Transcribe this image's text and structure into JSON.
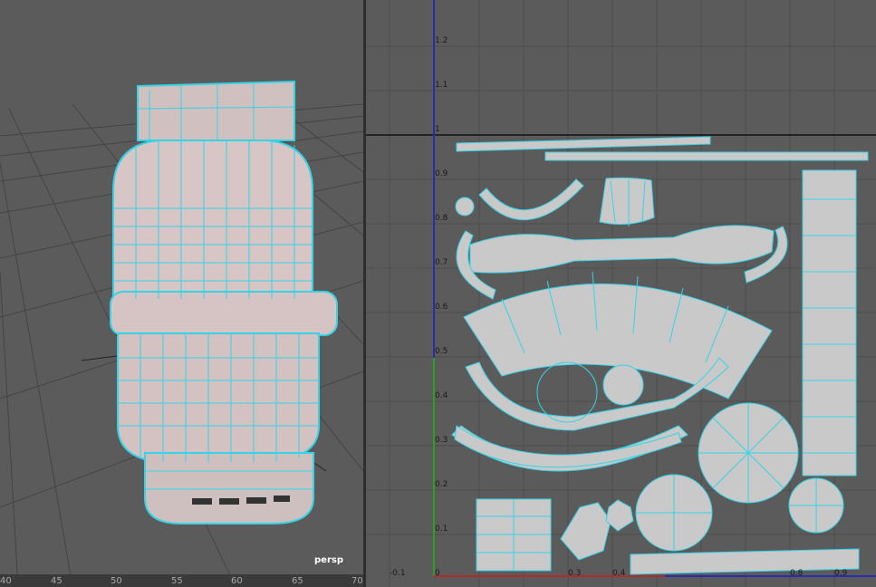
{
  "viewport": {
    "camera_label": "persp",
    "timeline_labels": [
      "40",
      "45",
      "50",
      "55",
      "60",
      "65",
      "70"
    ]
  },
  "uv_editor": {
    "v_labels": [
      "1.2",
      "1.1",
      "1",
      "0.9",
      "0.8",
      "0.7",
      "0.6",
      "0.5",
      "0.4",
      "0.3",
      "0.2",
      "0.1"
    ],
    "u_labels": [
      "-0.1",
      "0",
      "0.3",
      "0.4",
      "0.8",
      "0.9"
    ]
  },
  "colors": {
    "background": "#5b5b5b",
    "wire": "#35d3e8",
    "shell": "#c9c9c9",
    "tank": "#d8c6c6"
  }
}
